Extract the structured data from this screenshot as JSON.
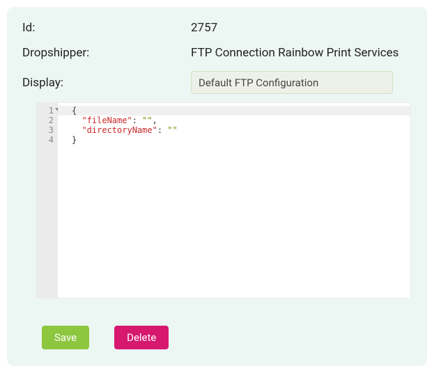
{
  "form": {
    "id_label": "Id:",
    "id_value": "2757",
    "dropshipper_label": "Dropshipper:",
    "dropshipper_value": "FTP Connection Rainbow Print Services",
    "display_label": "Display:",
    "display_value": "Default FTP Configuration"
  },
  "editor": {
    "line_numbers": [
      "1",
      "2",
      "3",
      "4"
    ],
    "line1_brace_open": "{",
    "indent": "  ",
    "key1": "\"fileName\"",
    "colon": ": ",
    "val1": "\"\"",
    "comma": ",",
    "key2": "\"directoryName\"",
    "val2": "\"\"",
    "line4_brace_close": "}"
  },
  "buttons": {
    "save": "Save",
    "delete": "Delete"
  }
}
